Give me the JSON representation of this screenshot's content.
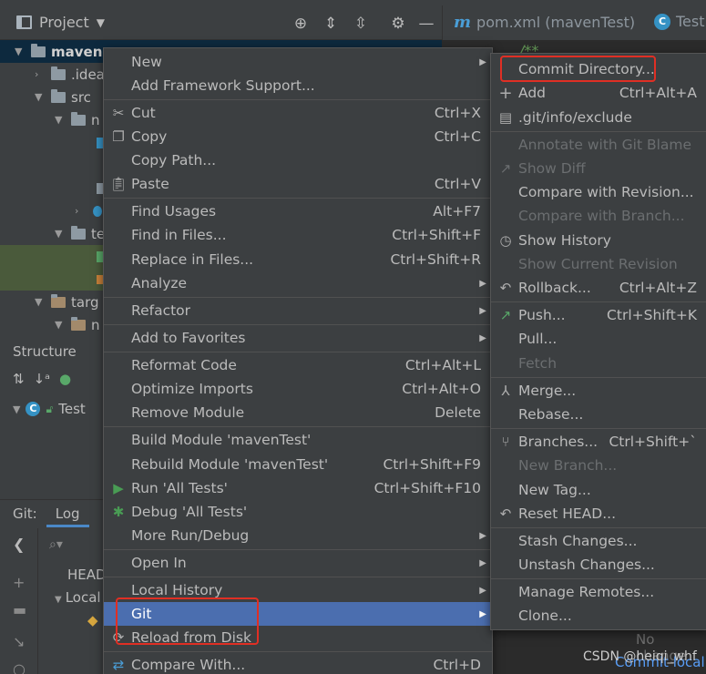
{
  "project_toolbar": {
    "title": "Project",
    "dropdown_icon": "chevron-down-icon",
    "buttons": [
      "crosshair-icon",
      "expand-all-icon",
      "collapse-all-icon",
      "gear-icon",
      "minimize-icon"
    ]
  },
  "editor_tabs": [
    {
      "label": "pom.xml (mavenTest)",
      "icon": "m"
    },
    {
      "label": "Test.",
      "icon": "C"
    }
  ],
  "editor": {
    "comment_fragment": "/**"
  },
  "tree": {
    "root": "maven",
    "idea": ".idea",
    "src": "src",
    "sub_n": "n",
    "sub_t": "te",
    "target": "targ",
    "target_n": "n"
  },
  "structure": {
    "header": "Structure",
    "item": "Test"
  },
  "git_panel": {
    "title": "Git:",
    "tab": "Log",
    "refs": [
      "HEAD",
      "Local"
    ]
  },
  "main_menu": {
    "items": [
      {
        "label": "New",
        "submenu": true
      },
      {
        "label": "Add Framework Support..."
      },
      {
        "label": "Cut",
        "shortcut": "Ctrl+X",
        "icon": "cut-icon"
      },
      {
        "label": "Copy",
        "shortcut": "Ctrl+C",
        "icon": "copy-icon"
      },
      {
        "label": "Copy Path..."
      },
      {
        "label": "Paste",
        "shortcut": "Ctrl+V",
        "icon": "paste-icon"
      },
      {
        "label": "Find Usages",
        "shortcut": "Alt+F7"
      },
      {
        "label": "Find in Files...",
        "shortcut": "Ctrl+Shift+F"
      },
      {
        "label": "Replace in Files...",
        "shortcut": "Ctrl+Shift+R"
      },
      {
        "label": "Analyze",
        "submenu": true
      },
      {
        "label": "Refactor",
        "submenu": true
      },
      {
        "label": "Add to Favorites",
        "submenu": true
      },
      {
        "label": "Reformat Code",
        "shortcut": "Ctrl+Alt+L"
      },
      {
        "label": "Optimize Imports",
        "shortcut": "Ctrl+Alt+O"
      },
      {
        "label": "Remove Module",
        "shortcut": "Delete"
      },
      {
        "label": "Build Module 'mavenTest'"
      },
      {
        "label": "Rebuild Module 'mavenTest'",
        "shortcut": "Ctrl+Shift+F9"
      },
      {
        "label": "Run 'All Tests'",
        "shortcut": "Ctrl+Shift+F10",
        "icon": "run-icon"
      },
      {
        "label": "Debug 'All Tests'",
        "icon": "debug-icon"
      },
      {
        "label": "More Run/Debug",
        "submenu": true
      },
      {
        "label": "Open In",
        "submenu": true
      },
      {
        "label": "Local History",
        "submenu": true
      },
      {
        "label": "Git",
        "submenu": true,
        "active": true
      },
      {
        "label": "Reload from Disk",
        "icon": "reload-icon"
      },
      {
        "label": "Compare With...",
        "shortcut": "Ctrl+D",
        "icon": "compare-icon"
      }
    ]
  },
  "git_menu": {
    "items": [
      {
        "label": "Commit Directory..."
      },
      {
        "label": "Add",
        "shortcut": "Ctrl+Alt+A",
        "icon": "plus-icon"
      },
      {
        "label": ".git/info/exclude",
        "icon": "git-exclude-icon"
      },
      {
        "label": "Annotate with Git Blame",
        "disabled": true
      },
      {
        "label": "Show Diff",
        "disabled": true,
        "icon": "diff-icon"
      },
      {
        "label": "Compare with Revision..."
      },
      {
        "label": "Compare with Branch...",
        "disabled": true
      },
      {
        "label": "Show History",
        "icon": "history-icon"
      },
      {
        "label": "Show Current Revision",
        "disabled": true
      },
      {
        "label": "Rollback...",
        "shortcut": "Ctrl+Alt+Z",
        "icon": "rollback-icon"
      },
      {
        "label": "Push...",
        "shortcut": "Ctrl+Shift+K",
        "icon": "push-icon"
      },
      {
        "label": "Pull..."
      },
      {
        "label": "Fetch",
        "disabled": true
      },
      {
        "label": "Merge...",
        "icon": "merge-icon"
      },
      {
        "label": "Rebase..."
      },
      {
        "label": "Branches...",
        "shortcut": "Ctrl+Shift+`",
        "icon": "branch-icon"
      },
      {
        "label": "New Branch...",
        "disabled": true
      },
      {
        "label": "New Tag..."
      },
      {
        "label": "Reset HEAD...",
        "icon": "reset-icon"
      },
      {
        "label": "Stash Changes..."
      },
      {
        "label": "Unstash Changes..."
      },
      {
        "label": "Manage Remotes..."
      },
      {
        "label": "Clone..."
      }
    ]
  },
  "footer": {
    "no_changes": "No change",
    "commit_local": "Commit local",
    "watermark": "CSDN @heiqi_whf"
  },
  "colors": {
    "menu_bg": "#3c3f41",
    "selection": "#4b6eaf",
    "highlight_box": "#e02f24",
    "disabled_text": "#6b6e70"
  }
}
